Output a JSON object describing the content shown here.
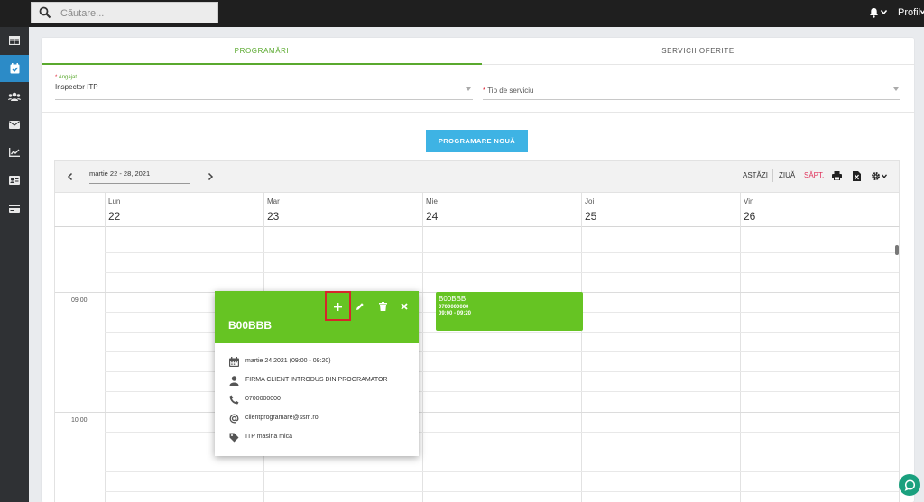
{
  "topbar": {
    "search_placeholder": "Căutare...",
    "profile_label": "Profil"
  },
  "sidebar": {
    "items": [
      {
        "icon": "table-icon",
        "active": false
      },
      {
        "icon": "calendar-icon",
        "active": true
      },
      {
        "icon": "users-icon",
        "active": false
      },
      {
        "icon": "envelope-icon",
        "active": false
      },
      {
        "icon": "chart-icon",
        "active": false
      },
      {
        "icon": "id-card-icon",
        "active": false
      },
      {
        "icon": "credit-card-icon",
        "active": false
      }
    ]
  },
  "tabs": {
    "appointments": "PROGRAMĂRI",
    "services": "SERVICII OFERITE"
  },
  "form": {
    "employee_label_req": "*",
    "employee_label": "Angajat",
    "employee_value": "Inspector ITP",
    "service_type_req": "*",
    "service_type_label": "Tip de serviciu"
  },
  "new_appointment_button": "PROGRAMARE NOUĂ",
  "calendar": {
    "date_range": "martie 22 - 28, 2021",
    "today": "ASTĂZI",
    "day_view": "ZIUĂ",
    "week_view": "SĂPT.",
    "days": [
      {
        "name": "Lun",
        "num": "22"
      },
      {
        "name": "Mar",
        "num": "23"
      },
      {
        "name": "Mie",
        "num": "24"
      },
      {
        "name": "Joi",
        "num": "25"
      },
      {
        "name": "Vin",
        "num": "26"
      }
    ],
    "time_labels": [
      "09:00",
      "10:00"
    ]
  },
  "event": {
    "title": "B00BBB",
    "phone": "0700000000",
    "time": "09:00 - 09:20"
  },
  "popup": {
    "title": "B00BBB",
    "date": "martie 24 2021 (09:00 - 09:20)",
    "client": "FIRMA CLIENT INTRODUS DIN PROGRAMATOR",
    "phone": "0700000000",
    "email": "clientprogramare@ssm.ro",
    "service": "ITP masina mica"
  },
  "colors": {
    "accent_green": "#66c423",
    "tab_green": "#5aa92e",
    "button_blue": "#3eb3e4",
    "sidebar_active": "#2c8bc7",
    "week_active": "#e0315a"
  }
}
